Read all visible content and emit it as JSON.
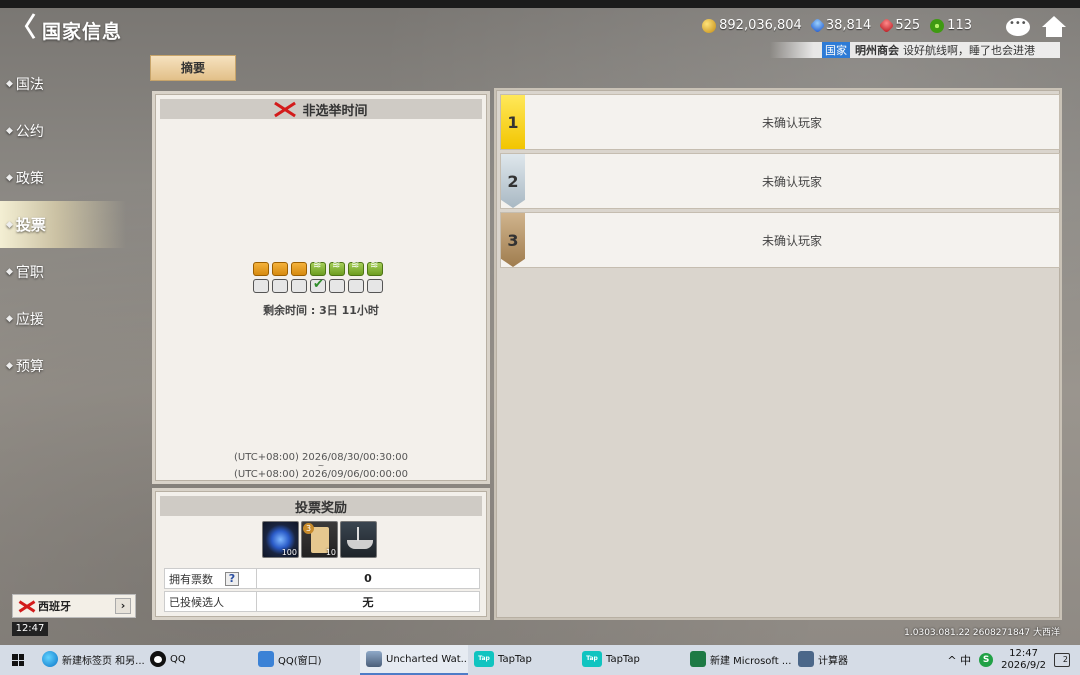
{
  "header": {
    "title": "国家信息",
    "back_label": "〈",
    "resources": [
      {
        "icon": "gold-coin-icon",
        "value": "892,036,804"
      },
      {
        "icon": "blue-gem-icon",
        "value": "38,814"
      },
      {
        "icon": "red-gem-icon",
        "value": "525"
      },
      {
        "icon": "green-gear-icon",
        "value": "113"
      }
    ],
    "ticker": {
      "tag": "国家",
      "sender": "明州商会",
      "message": "设好航线啊，睡了也会进港"
    }
  },
  "sidebar": {
    "items": [
      {
        "label": "国法",
        "active": false
      },
      {
        "label": "公约",
        "active": false
      },
      {
        "label": "政策",
        "active": false
      },
      {
        "label": "投票",
        "active": true
      },
      {
        "label": "官职",
        "active": false
      },
      {
        "label": "应援",
        "active": false
      },
      {
        "label": "预算",
        "active": false
      }
    ],
    "nation": "西班牙",
    "chevron": "›",
    "clock": "12:47"
  },
  "tabs": {
    "summary": "摘要"
  },
  "election": {
    "title": "非选举时间",
    "remaining": "剩余时间 : 3日 11小时",
    "start_time": "(UTC+08:00) 2026/08/30/00:30:00",
    "dash": "~",
    "end_time": "(UTC+08:00) 2026/09/06/00:00:00"
  },
  "rewards": {
    "title": "投票奖励",
    "items": [
      {
        "icon": "sapphire-gem-icon",
        "qty": "100"
      },
      {
        "icon": "ticket-icon",
        "qty": "10",
        "badge": "3"
      },
      {
        "icon": "ship-icon",
        "qty": ""
      }
    ],
    "votes_label": "拥有票数",
    "help": "?",
    "votes_value": "0",
    "voted_label": "已投候选人",
    "voted_value": "无"
  },
  "ranking": [
    {
      "rank": "1",
      "name": "未确认玩家"
    },
    {
      "rank": "2",
      "name": "未确认玩家"
    },
    {
      "rank": "3",
      "name": "未确认玩家"
    }
  ],
  "version": "1.0303.081.22 2608271847 大西洋",
  "taskbar": {
    "apps": [
      {
        "icon": "edge-icon",
        "label": "新建标签页 和另..."
      },
      {
        "icon": "qq-icon",
        "label": "QQ"
      },
      {
        "icon": "qq-window-icon",
        "label": "QQ(窗口)"
      },
      {
        "icon": "game-icon",
        "label": "Uncharted Wat..."
      },
      {
        "icon": "taptap-icon",
        "label": "TapTap"
      },
      {
        "icon": "taptap-icon",
        "label": "TapTap"
      },
      {
        "icon": "excel-icon",
        "label": "新建 Microsoft ..."
      },
      {
        "icon": "calculator-icon",
        "label": "计算器"
      }
    ],
    "tray_symbols": "^ 中",
    "time": "12:47",
    "date": "2026/9/2",
    "notif_count": "2"
  }
}
